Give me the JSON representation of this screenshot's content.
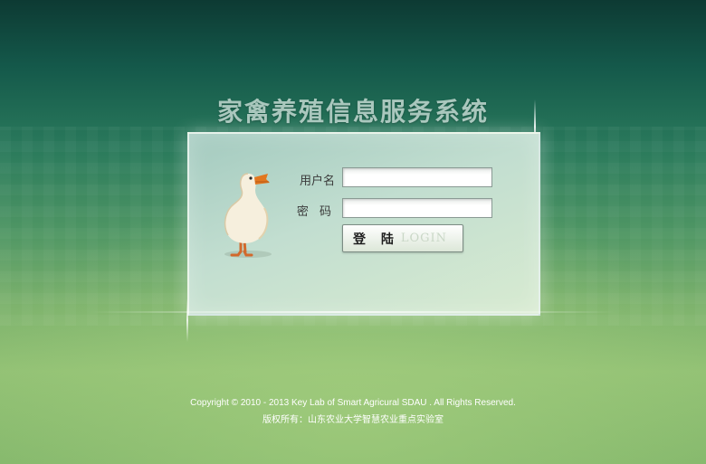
{
  "page": {
    "title": "家禽养殖信息服务系统"
  },
  "login": {
    "username_label": "用户名",
    "password_label": "密 码",
    "username_value": "",
    "password_value": "",
    "button_label_cn": "登 陆",
    "button_label_en": "LOGIN"
  },
  "footer": {
    "copyright": "Copyright © 2010 - 2013 Key Lab of Smart Agricural SDAU . All Rights Reserved.",
    "owner": "版权所有：山东农业大学智慧农业重点实验室"
  },
  "colors": {
    "background_top": "#0d3a33",
    "background_bottom": "#93c275",
    "title": "#a9c7bd",
    "panel": "#c2ded0"
  },
  "icons": {
    "mascot": "duck-mascot-icon"
  }
}
